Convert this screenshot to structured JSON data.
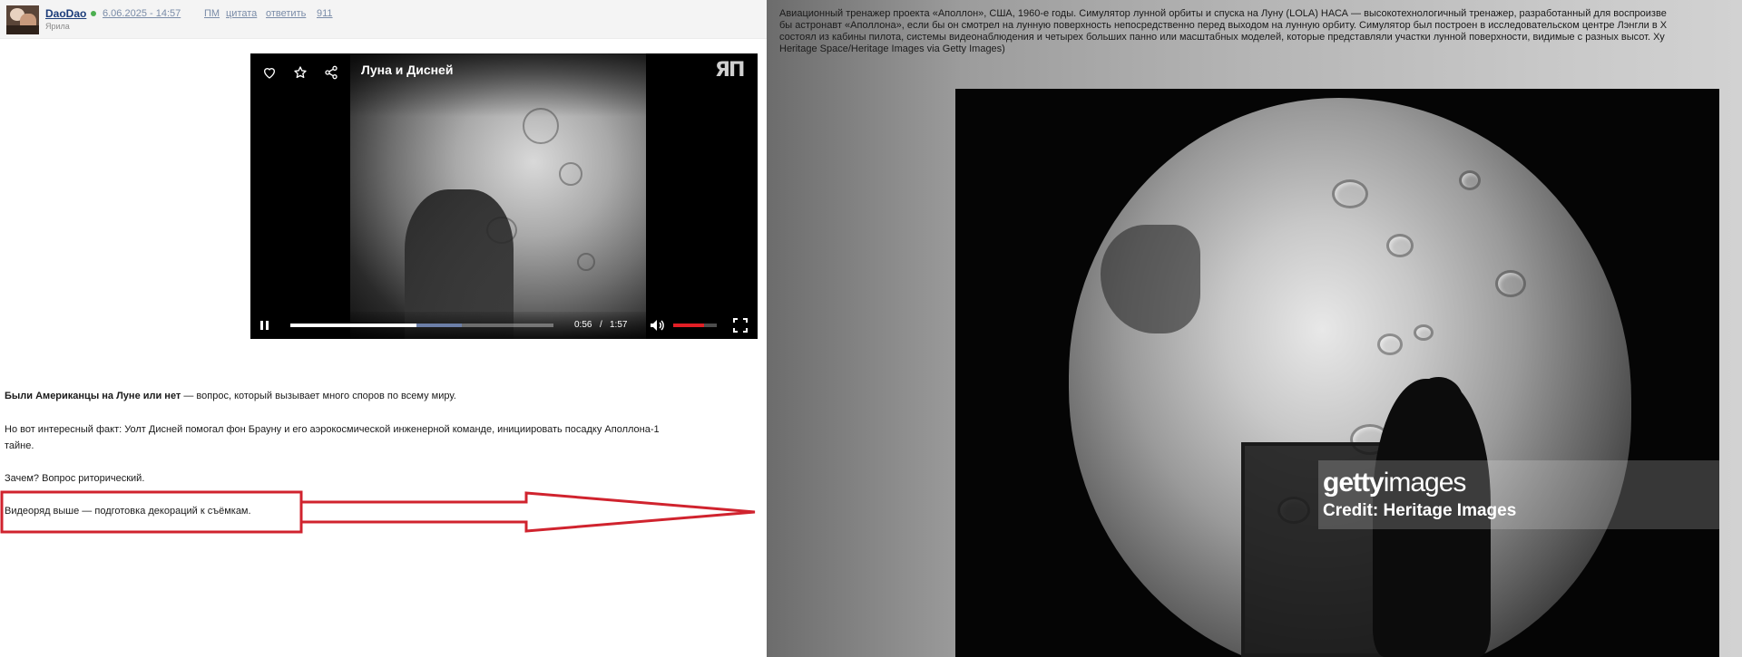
{
  "post": {
    "username": "DaoDao",
    "date": "6.06.2025 - 14:57",
    "links": [
      "ПМ",
      "цитата",
      "ответить",
      "911"
    ],
    "user_title": "Ярила"
  },
  "video": {
    "title": "Луна и Дисней",
    "logo": "ЯП",
    "current_time": "0:56",
    "time_separator": "/",
    "duration": "1:57",
    "progress_fraction": 0.48,
    "buffered_fraction": 0.65,
    "volume_fraction": 0.7,
    "accent_color": "#e21f26"
  },
  "text": {
    "p1_bold": "Были Американцы на Луне или нет",
    "p1_rest": " — вопрос, который вызывает много споров по всему миру.",
    "p2_line1": "Но вот интересный факт: Уолт Дисней помогал фон Брауну и его аэрокосмической инженерной команде, инициировать посадку Аполлона-1",
    "p2_line2": "тайне.",
    "p3": "Зачем? Вопрос риторический.",
    "p4": "Видеоряд выше — подготовка декораций к съёмкам."
  },
  "annotation": {
    "color": "#d0232e"
  },
  "getty": {
    "caption_line1": "Авиационный тренажер проекта «Аполлон», США, 1960-е годы. Симулятор лунной орбиты и спуска на Луну (LOLA) НАСА — высокотехнологичный тренажер, разработанный для воспроизве",
    "caption_line2": "бы астронавт «Аполлона», если бы он смотрел на лунную поверхность непосредственно перед выходом на лунную орбиту. Симулятор был построен в исследовательском центре Лэнгли в Х",
    "caption_line3": "состоял из кабины пилота, системы видеонаблюдения и четырех больших панно или масштабных моделей, которые представляли участки лунной поверхности, видимые с разных высот. Ху",
    "caption_line4": "Heritage Space/Heritage Images via Getty Images)",
    "logo_bold": "getty",
    "logo_light": "images",
    "credit": "Credit: Heritage Images"
  }
}
